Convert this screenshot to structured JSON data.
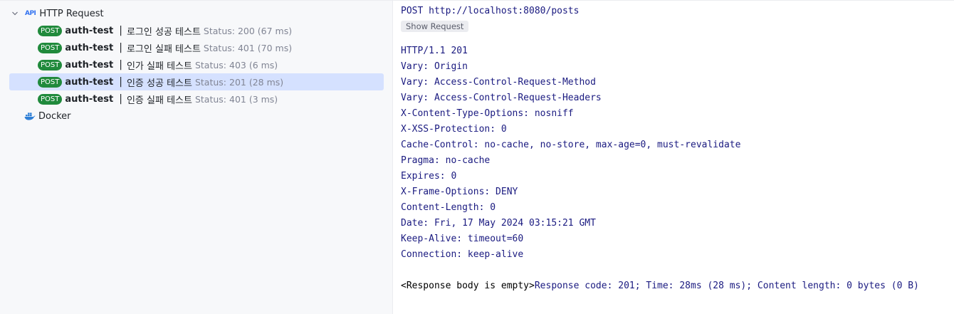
{
  "tree": {
    "root_label": "HTTP Request",
    "root_icon": "api-icon",
    "requests": [
      {
        "method": "POST",
        "name": "auth-test",
        "separator": "|",
        "description": "로그인 성공 테스트",
        "status": "Status: 200 (67 ms)",
        "selected": false
      },
      {
        "method": "POST",
        "name": "auth-test",
        "separator": "|",
        "description": "로그인 실패 테스트",
        "status": "Status: 401 (70 ms)",
        "selected": false
      },
      {
        "method": "POST",
        "name": "auth-test",
        "separator": "|",
        "description": "인가 실패 테스트",
        "status": "Status: 403 (6 ms)",
        "selected": false
      },
      {
        "method": "POST",
        "name": "auth-test",
        "separator": "|",
        "description": "인증 성공 테스트",
        "status": "Status: 201 (28 ms)",
        "selected": true
      },
      {
        "method": "POST",
        "name": "auth-test",
        "separator": "|",
        "description": "인증 실패 테스트",
        "status": "Status: 401 (3 ms)",
        "selected": false
      }
    ],
    "docker_label": "Docker"
  },
  "response": {
    "request_line": "POST http://localhost:8080/posts",
    "show_request_label": "Show Request",
    "status_line": "HTTP/1.1 201",
    "headers": [
      "Vary: Origin",
      "Vary: Access-Control-Request-Method",
      "Vary: Access-Control-Request-Headers",
      "X-Content-Type-Options: nosniff",
      "X-XSS-Protection: 0",
      "Cache-Control: no-cache, no-store, max-age=0, must-revalidate",
      "Pragma: no-cache",
      "Expires: 0",
      "X-Frame-Options: DENY",
      "Content-Length: 0",
      "Date: Fri, 17 May 2024 03:15:21 GMT",
      "Keep-Alive: timeout=60",
      "Connection: keep-alive"
    ],
    "body_empty": "<Response body is empty>",
    "summary": "Response code: 201; Time: 28ms (28 ms); Content length: 0 bytes (0 B)"
  },
  "colors": {
    "badge_post": "#208a3c",
    "selected_row": "#d5e1ff",
    "status_text": "#818594",
    "response_text": "#1a1a80"
  }
}
